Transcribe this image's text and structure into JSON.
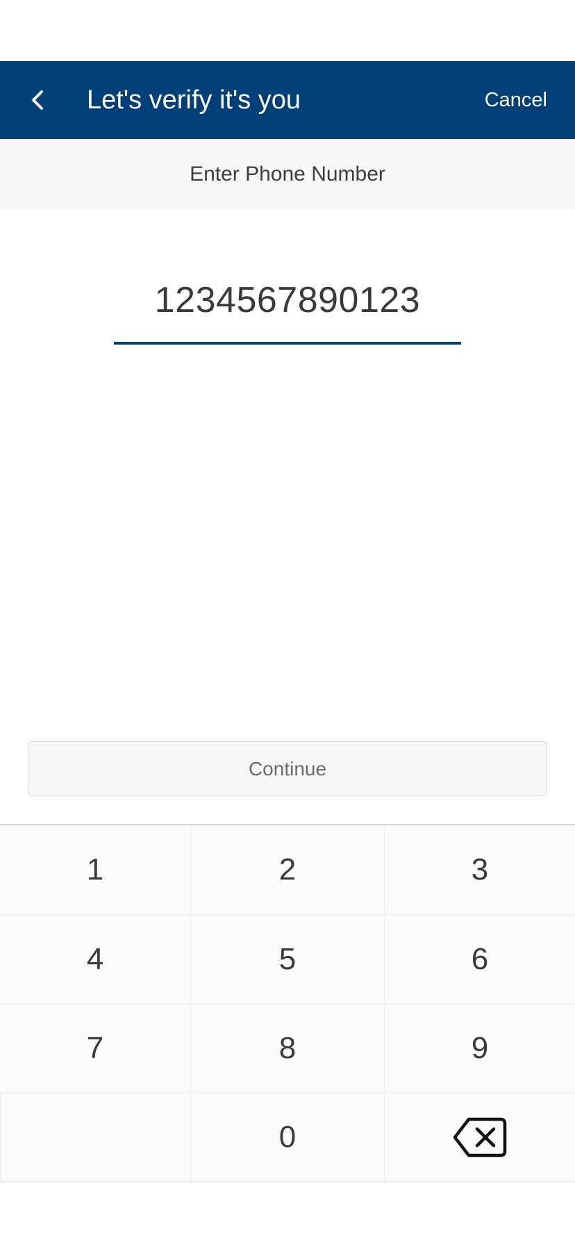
{
  "header": {
    "title": "Let's verify it's you",
    "cancel_label": "Cancel",
    "background": "#003f78"
  },
  "subheader": {
    "text": "Enter Phone Number"
  },
  "phone_input": {
    "value": "1234567890123"
  },
  "continue_button": {
    "label": "Continue"
  },
  "keypad": {
    "keys": [
      "1",
      "2",
      "3",
      "4",
      "5",
      "6",
      "7",
      "8",
      "9",
      "0"
    ],
    "delete_icon": "backspace-icon"
  }
}
